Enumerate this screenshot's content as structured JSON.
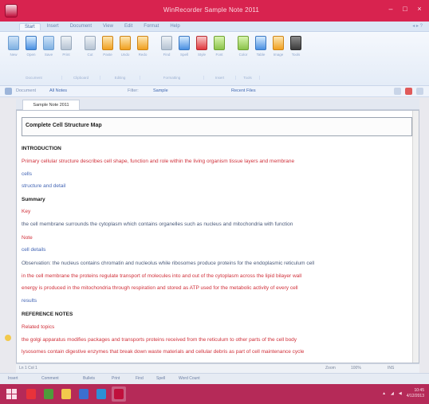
{
  "window": {
    "title": "WinRecorder Sample Note 2011"
  },
  "ribbon_tabs": [
    "Start",
    "Insert",
    "Document",
    "View",
    "Edit",
    "Format",
    "Help"
  ],
  "ribbon_tabs_right": "◂ ▸ ?",
  "ribbon_buttons": [
    {
      "label": "New",
      "color": "doc"
    },
    {
      "label": "Open",
      "color": "blue"
    },
    {
      "label": "Save",
      "color": "doc"
    },
    {
      "label": "Print",
      "color": "gray"
    },
    {
      "label": "Cut",
      "color": "gray"
    },
    {
      "label": "Paste",
      "color": "orange"
    },
    {
      "label": "Undo",
      "color": "orange"
    },
    {
      "label": "Redo",
      "color": "orange"
    },
    {
      "label": "Find",
      "color": "gray"
    },
    {
      "label": "Spell",
      "color": "blue"
    },
    {
      "label": "Style",
      "color": "red"
    },
    {
      "label": "Font",
      "color": "green"
    },
    {
      "label": "Color",
      "color": "green"
    },
    {
      "label": "Table",
      "color": "blue"
    },
    {
      "label": "Image",
      "color": "orange"
    },
    {
      "label": "Tools",
      "color": "dark"
    }
  ],
  "ribbon_groups": [
    "Document",
    "Clipboard",
    "Editing",
    "Formatting",
    "Insert",
    "Tools"
  ],
  "subbar": {
    "left_label": "Document",
    "left_link": "All Notes",
    "mid_label": "Filter:",
    "mid_link": "Sample",
    "right_link": "Recent Files"
  },
  "document_tab": "Sample Note 2011",
  "editor": {
    "header": "Complete Cell Structure Map",
    "lines": [
      {
        "kind": "head",
        "text": "INTRODUCTION"
      },
      {
        "kind": "red",
        "text": "Primary cellular structure describes cell shape, function and role within the living organism tissue layers and membrane"
      },
      {
        "kind": "blue",
        "text": "cells"
      },
      {
        "kind": "blue",
        "text": "structure and detail"
      },
      {
        "kind": "head",
        "text": "Summary"
      },
      {
        "kind": "red",
        "text": "Key"
      },
      {
        "kind": "mixed",
        "text": "the cell membrane surrounds the cytoplasm which contains organelles such as nucleus and mitochondria with function"
      },
      {
        "kind": "red",
        "text": "Note"
      },
      {
        "kind": "blue",
        "text": "cell details"
      },
      {
        "kind": "mixed",
        "text": "Observation: the nucleus contains chromatin and nucleolus while ribosomes produce proteins for the endoplasmic reticulum cell"
      },
      {
        "kind": "red",
        "text": "in the cell membrane the proteins regulate transport of molecules into and out of the cytoplasm across the lipid bilayer wall"
      },
      {
        "kind": "red",
        "text": "energy is produced in the mitochondria through respiration and stored as ATP used for the metabolic activity of every cell"
      },
      {
        "kind": "blue",
        "text": "results"
      },
      {
        "kind": "head",
        "text": "REFERENCE NOTES"
      },
      {
        "kind": "red",
        "text": "Related topics"
      },
      {
        "kind": "red",
        "text": "the golgi apparatus modifies packages and transports proteins received from the reticulum to other parts of the cell body"
      },
      {
        "kind": "red",
        "text": "lysosomes contain digestive enzymes that break down waste materials and cellular debris as part of cell maintenance cycle"
      }
    ]
  },
  "status_top": {
    "left": "Ln 1  Col 1",
    "right_a": "Zoom",
    "right_b": "100%",
    "right_c": "INS"
  },
  "status_bottom": [
    "Insert",
    "Comment",
    "Bullets",
    "Print",
    "Find",
    "Spell",
    "Word Count"
  ],
  "tray": {
    "time": "10:45",
    "date": "4/12/2013"
  }
}
